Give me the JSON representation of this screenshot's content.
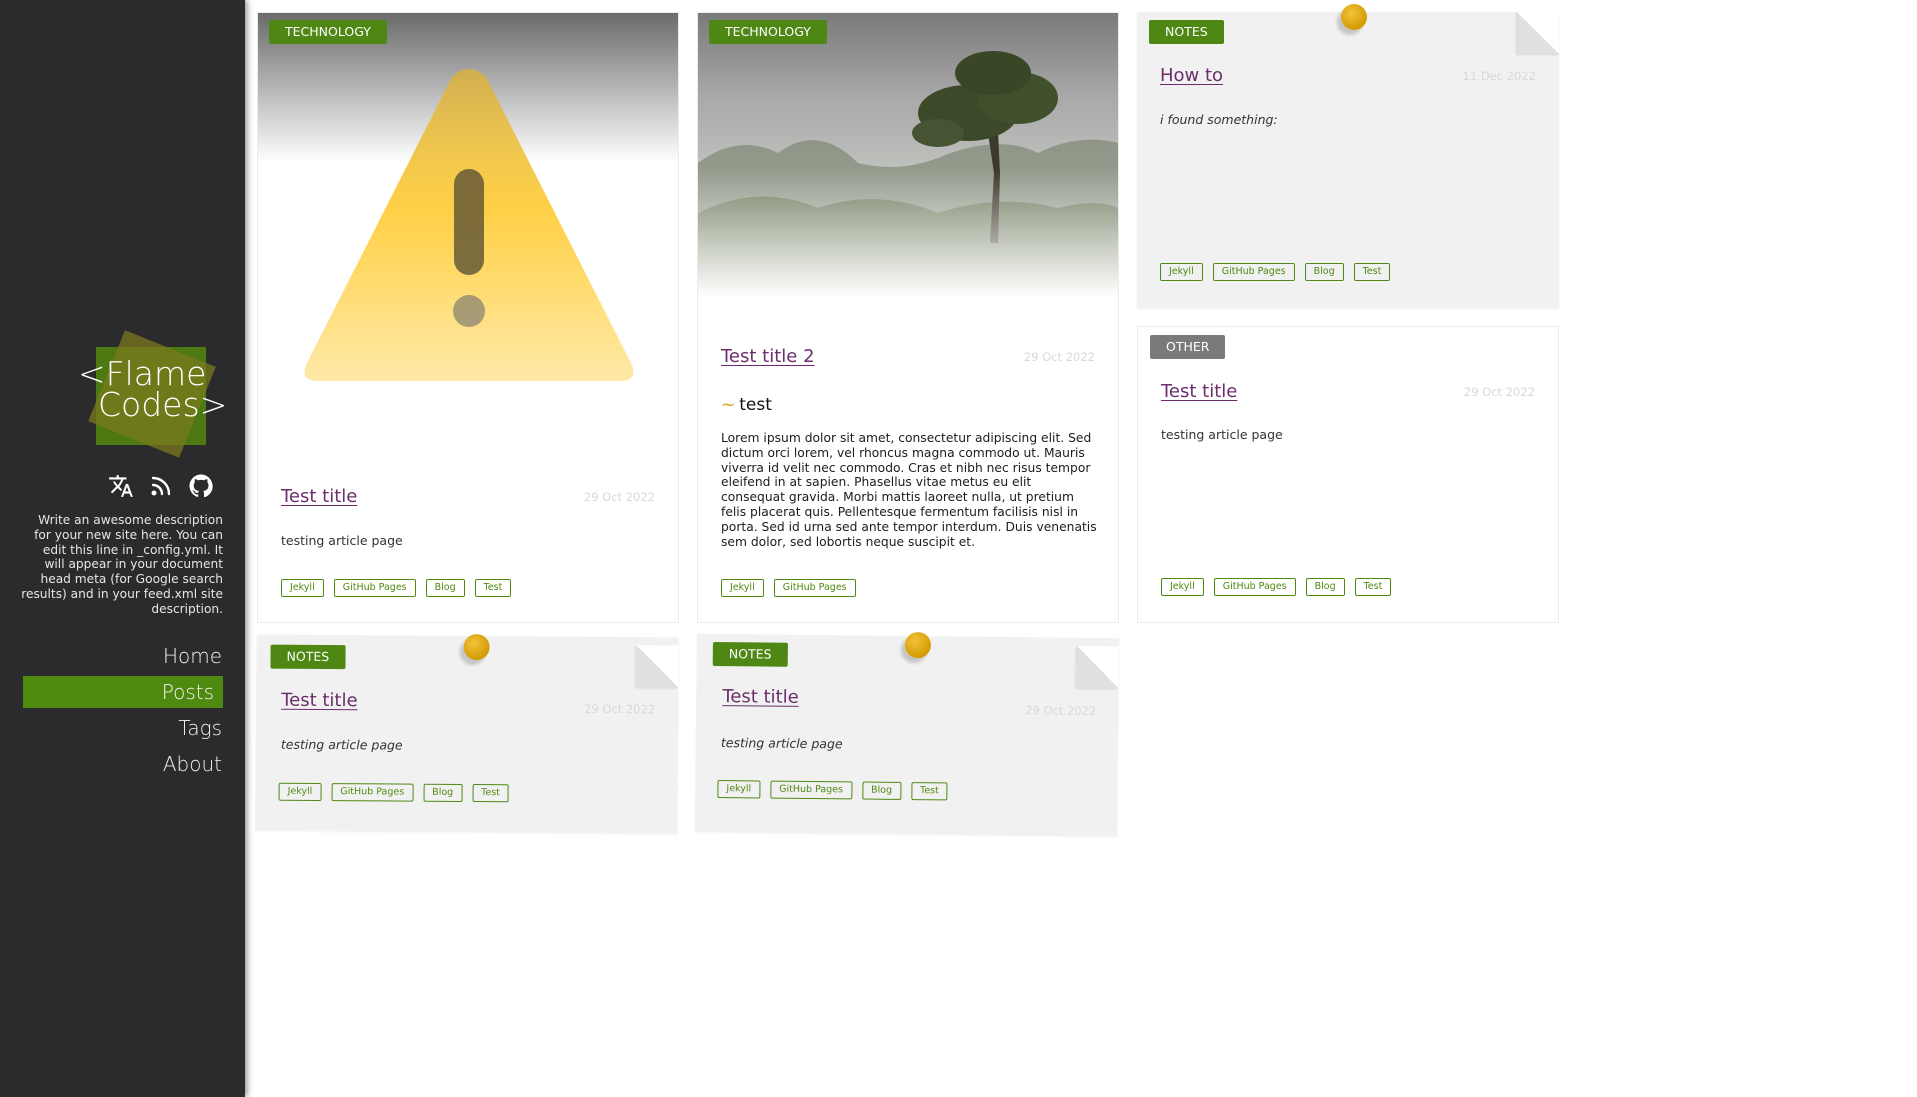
{
  "site": {
    "logo_line1": "<Flame",
    "logo_line2": "Codes>",
    "description": "Write an awesome description for your new site here. You can edit this line in _config.yml. It will appear in your document head meta (for Google search results) and in your feed.xml site description.",
    "social_icons": [
      "translate-icon",
      "rss-icon",
      "github-icon"
    ]
  },
  "nav": {
    "items": [
      {
        "label": "Home",
        "active": false
      },
      {
        "label": "Posts",
        "active": true
      },
      {
        "label": "Tags",
        "active": false
      },
      {
        "label": "About",
        "active": false
      }
    ]
  },
  "colors": {
    "accent": "#4e8713",
    "link": "#6b2d6b",
    "sidebar": "#2b2b2d",
    "pin": "#e0a912"
  },
  "posts": [
    {
      "category": "TECHNOLOGY",
      "title": "Test title",
      "date": "29 Oct 2022",
      "excerpt": "testing article page",
      "tags": [
        "Jekyll",
        "GitHub Pages",
        "Blog",
        "Test"
      ],
      "image": "warning-triangle-image"
    },
    {
      "category": "TECHNOLOGY",
      "title": "Test title 2",
      "date": "29 Oct 2022",
      "heading": "test",
      "excerpt": "Lorem ipsum dolor sit amet, consectetur adipiscing elit. Sed dictum orci lorem, vel rhoncus magna commodo ut. Mauris viverra id velit nec commodo. Cras et nibh nec risus tempor eleifend in at sapien. Phasellus vitae metus eu elit consequat gravida. Morbi mattis laoreet nulla, ut pretium felis placerat quis. Pellentesque fermentum facilisis nisl in porta. Sed id urna sed ante tempor interdum. Duis venenatis sem dolor, sed lobortis neque suscipit et.",
      "tags": [
        "Jekyll",
        "GitHub Pages"
      ],
      "image": "misty-forest-image"
    },
    {
      "category": "NOTES",
      "title": "How to",
      "date": "11 Dec 2022",
      "excerpt": "i found something:",
      "tags": [
        "Jekyll",
        "GitHub Pages",
        "Blog",
        "Test"
      ]
    },
    {
      "category": "OTHER",
      "title": "Test title",
      "date": "29 Oct 2022",
      "excerpt": "testing article page",
      "tags": [
        "Jekyll",
        "GitHub Pages",
        "Blog",
        "Test"
      ]
    },
    {
      "category": "NOTES",
      "title": "Test title",
      "date": "29 Oct 2022",
      "excerpt": "testing article page",
      "tags": [
        "Jekyll",
        "GitHub Pages",
        "Blog",
        "Test"
      ]
    },
    {
      "category": "NOTES",
      "title": "Test title",
      "date": "29 Oct 2022",
      "excerpt": "testing article page",
      "tags": [
        "Jekyll",
        "GitHub Pages",
        "Blog",
        "Test"
      ]
    }
  ]
}
